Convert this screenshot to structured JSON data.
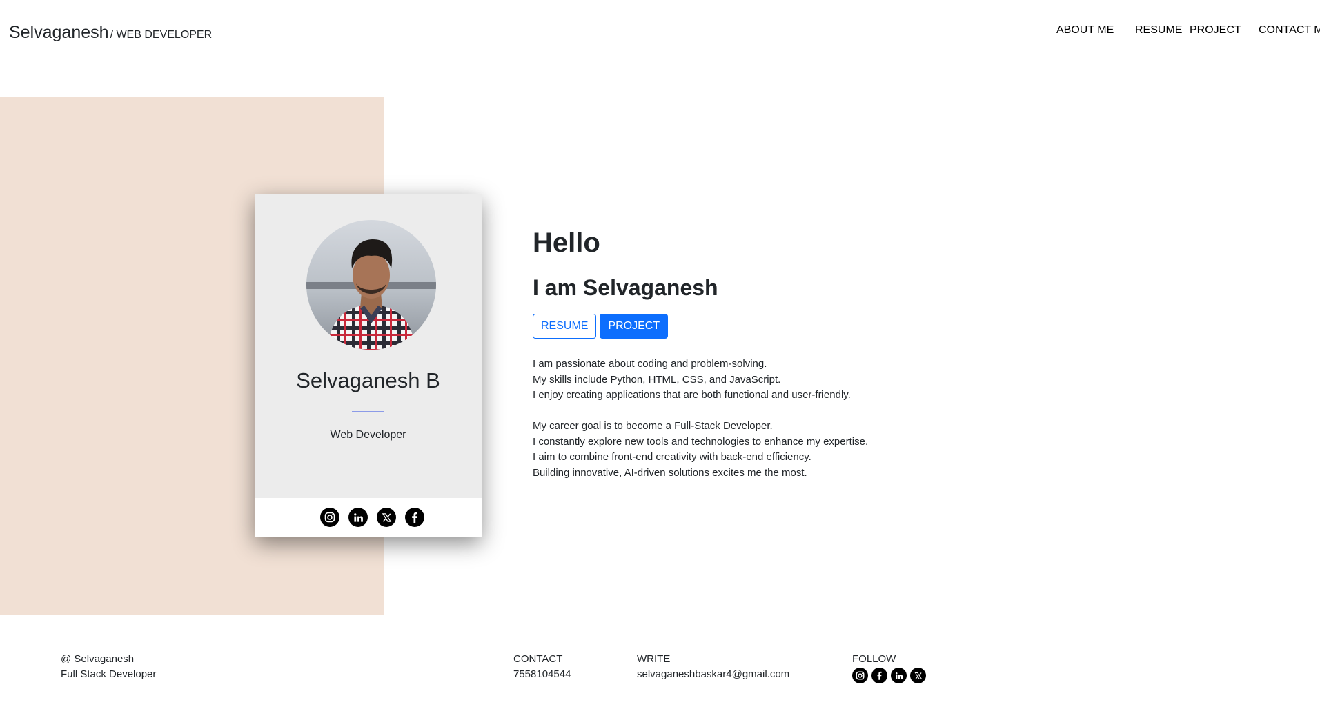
{
  "header": {
    "brand_name": "Selvaganesh",
    "brand_role": "/ WEB DEVELOPER",
    "nav": [
      "ABOUT ME",
      "RESUME",
      "PROJECT",
      "CONTACT ME"
    ]
  },
  "card": {
    "name": "Selvaganesh B",
    "role": "Web Developer",
    "socials": [
      "instagram-icon",
      "linkedin-icon",
      "x-icon",
      "facebook-icon"
    ]
  },
  "intro": {
    "greeting": "Hello",
    "headline": "I am Selvaganesh",
    "resume_button": "RESUME",
    "project_button": "PROJECT",
    "paragraph1": [
      "I am passionate about coding and problem-solving.",
      "My skills include Python, HTML, CSS, and JavaScript.",
      "I enjoy creating applications that are both functional and user-friendly."
    ],
    "paragraph2": [
      "My career goal is to become a Full-Stack Developer.",
      "I constantly explore new tools and technologies to enhance my expertise.",
      "I aim to combine front-end creativity with back-end efficiency.",
      "Building innovative, AI-driven solutions excites me the most."
    ]
  },
  "footer": {
    "copyright": "@ Selvaganesh",
    "title": "Full Stack Developer",
    "contact_label": "CONTACT",
    "contact_value": "7558104544",
    "write_label": "WRITE",
    "write_value": "selvaganeshbaskar4@gmail.com",
    "follow_label": "FOLLOW",
    "follow_icons": [
      "instagram-icon",
      "facebook-icon",
      "linkedin-icon",
      "x-icon"
    ]
  },
  "colors": {
    "hero_background": "#f1e0d4",
    "card_background": "#ececec",
    "primary": "#0d6efd"
  }
}
